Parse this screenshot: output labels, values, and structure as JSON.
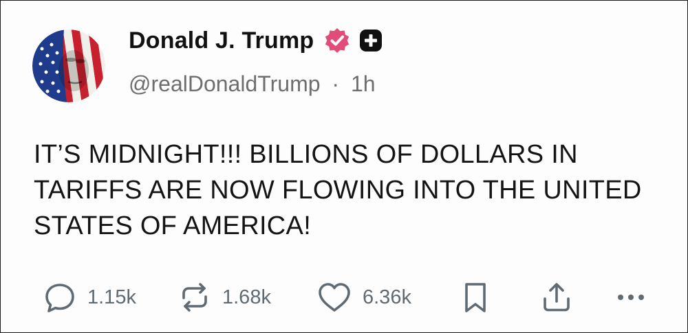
{
  "author": {
    "display_name": "Donald J. Trump",
    "handle": "@realDonaldTrump",
    "separator": "·",
    "time_ago": "1h",
    "verified_badge_color": "#e24c79"
  },
  "post": {
    "text": "IT’S MIDNIGHT!!! BILLIONS OF DOLLARS IN TARIFFS ARE NOW FLOWING INTO THE UNITED STATES OF AMERICA!"
  },
  "actions": {
    "replies": "1.15k",
    "reposts": "1.68k",
    "likes": "6.36k"
  },
  "icons": {
    "reply": "speech-bubble-icon",
    "repost": "repost-arrows-icon",
    "like": "heart-icon",
    "bookmark": "bookmark-icon",
    "share": "share-upload-icon",
    "more": "ellipsis-icon"
  },
  "colors": {
    "text": "#141414",
    "muted": "#6e6e6e",
    "icon": "#5f6a72",
    "avatar_blue": "#1f3b8c",
    "avatar_red": "#c8202f"
  }
}
